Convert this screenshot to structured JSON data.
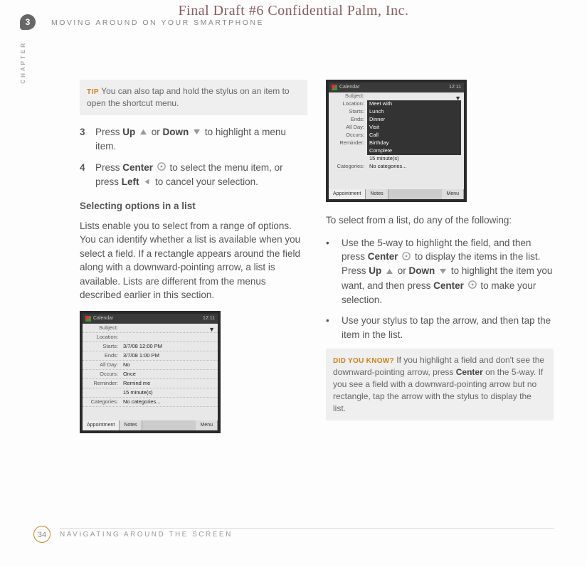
{
  "watermark": "Final Draft #6     Confidential     Palm, Inc.",
  "chapter_num": "3",
  "chapter_title": "MOVING AROUND ON YOUR SMARTPHONE",
  "chapter_side": "CHAPTER",
  "tip": {
    "label": "TIP",
    "text": " You can also tap and hold the stylus on an item to open the shortcut menu."
  },
  "steps": [
    {
      "num": "3",
      "parts": [
        "Press ",
        "Up",
        " ",
        "{up}",
        " or ",
        "Down",
        " ",
        "{down}",
        " to highlight a menu item."
      ]
    },
    {
      "num": "4",
      "parts": [
        "Press ",
        "Center",
        " ",
        "{center}",
        " to select the menu item, or press ",
        "Left",
        " ",
        "{left}",
        " to cancel your selection."
      ]
    }
  ],
  "subhead": "Selecting options in a list",
  "lists_para": "Lists enable you to select from a range of options. You can identify whether a list is available when you select a field. If a rectangle appears around the field along with a downward-pointing arrow, a list is available. Lists are different from the menus described earlier in this section.",
  "screenshot1": {
    "title": "Calendar",
    "time": "12:11",
    "rows": [
      {
        "label": "Subject:",
        "val": ""
      },
      {
        "label": "Location:",
        "val": ""
      },
      {
        "label": "Starts:",
        "val": "3/7/08    12:00 PM"
      },
      {
        "label": "Ends:",
        "val": "3/7/08    1:00 PM"
      },
      {
        "label": "All Day:",
        "val": "No"
      },
      {
        "label": "Occurs:",
        "val": "Once"
      },
      {
        "label": "Reminder:",
        "val": "Remind me"
      },
      {
        "label": "",
        "val": "15    minute(s)"
      },
      {
        "label": "Categories:",
        "val": "No categories..."
      }
    ],
    "tabs": [
      "Appointment",
      "Notes"
    ]
  },
  "screenshot2": {
    "title": "Calendar",
    "time": "12:11",
    "rows": [
      {
        "label": "Subject:",
        "val": ""
      },
      {
        "label": "Location:",
        "val": "Meet with"
      },
      {
        "label": "Starts:",
        "val": "Lunch"
      },
      {
        "label": "Ends:",
        "val": "Dinner"
      },
      {
        "label": "All Day:",
        "val": "Visit"
      },
      {
        "label": "Occurs:",
        "val": "Call"
      },
      {
        "label": "Reminder:",
        "val": "Birthday"
      },
      {
        "label": "",
        "val": "Complete"
      },
      {
        "label": "",
        "val2": "15    minute(s)"
      },
      {
        "label": "Categories:",
        "val2": "No categories..."
      }
    ],
    "tabs": [
      "Appointment",
      "Notes"
    ]
  },
  "col2_intro": "To select from a list, do any of the following:",
  "bullets": [
    {
      "parts": [
        "Use the 5-way to highlight the field, and then press ",
        "Center",
        " ",
        "{center}",
        " to display the items in the list. Press ",
        "Up",
        " ",
        "{up}",
        " or ",
        "Down",
        " ",
        "{down}",
        " to highlight the item you want, and then press ",
        "Center",
        " ",
        "{center}",
        " to make your selection."
      ]
    },
    {
      "parts": [
        "Use your stylus to tap the arrow, and then tap the item in the list."
      ]
    }
  ],
  "dyk": {
    "label": "DID YOU KNOW?",
    "parts": [
      " If you highlight a field and don't see the downward-pointing arrow, press ",
      "Center",
      " on the 5-way. If you see a field with a downward-pointing arrow but no rectangle, tap the arrow with the stylus to display the list."
    ]
  },
  "footer_num": "34",
  "footer_title": "NAVIGATING AROUND THE SCREEN"
}
